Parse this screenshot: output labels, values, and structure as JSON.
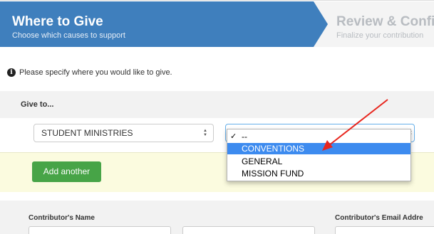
{
  "steps": [
    {
      "title": "Where to Give",
      "subtitle": "Choose which causes to support",
      "active": true
    },
    {
      "title": "Review & Confi",
      "subtitle": "Finalize your contribution",
      "active": false
    }
  ],
  "info": {
    "icon": "info-icon",
    "text": "Please specify where you would like to give."
  },
  "give_to": {
    "heading": "Give to...",
    "selected_fund": "STUDENT MINISTRIES",
    "dropdown": {
      "selected_index": 0,
      "options": [
        "--",
        "CONVENTIONS",
        "GENERAL",
        "MISSION FUND"
      ],
      "highlighted_index": 1
    },
    "add_button": "Add another"
  },
  "contributor": {
    "name_label": "Contributor's Name",
    "email_label": "Contributor's Email Addre"
  },
  "colors": {
    "step_active": "#3f7fbd",
    "highlight": "#3d8bef",
    "add_button": "#47a447",
    "panel_foot": "#fbfbdf",
    "annotation_arrow": "#e8261e"
  }
}
